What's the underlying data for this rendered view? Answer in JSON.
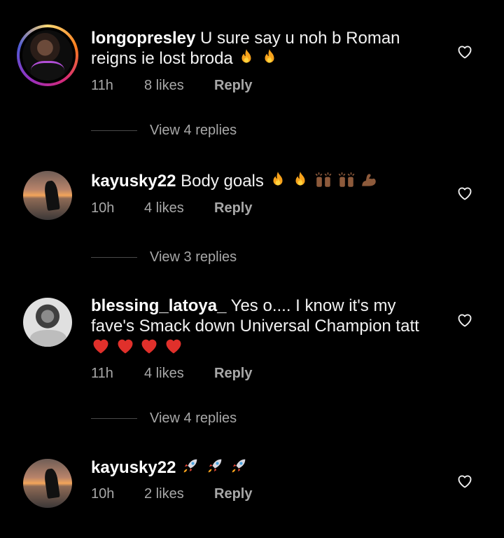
{
  "comments": [
    {
      "username": "longopresley",
      "text": "U sure say u noh b Roman reigns ie lost broda",
      "emojis": [
        "fire",
        "fire"
      ],
      "time": "11h",
      "likes": "8 likes",
      "reply": "Reply",
      "view_replies": "View 4 replies"
    },
    {
      "username": "kayusky22",
      "text": "Body goals",
      "emojis": [
        "fire",
        "fire",
        "raising-hands",
        "raising-hands",
        "flexed-biceps"
      ],
      "time": "10h",
      "likes": "4 likes",
      "reply": "Reply",
      "view_replies": "View 3 replies"
    },
    {
      "username": "blessing_latoya_",
      "text": "Yes o.... I know it's my fave's Smack down Universal Champion tatt",
      "emojis": [
        "red-heart",
        "red-heart",
        "red-heart",
        "red-heart"
      ],
      "time": "11h",
      "likes": "4 likes",
      "reply": "Reply",
      "view_replies": "View 4 replies"
    },
    {
      "username": "kayusky22",
      "text": "",
      "emojis": [
        "rocket",
        "rocket",
        "rocket"
      ],
      "time": "10h",
      "likes": "2 likes",
      "reply": "Reply"
    }
  ],
  "colors": {
    "background": "#000000",
    "secondary_text": "#a8a8a8",
    "primary_text": "#ffffff"
  },
  "icons": [
    "heart-outline-icon",
    "fire-emoji",
    "raising-hands-emoji",
    "flexed-biceps-emoji",
    "red-heart-emoji",
    "rocket-emoji"
  ]
}
